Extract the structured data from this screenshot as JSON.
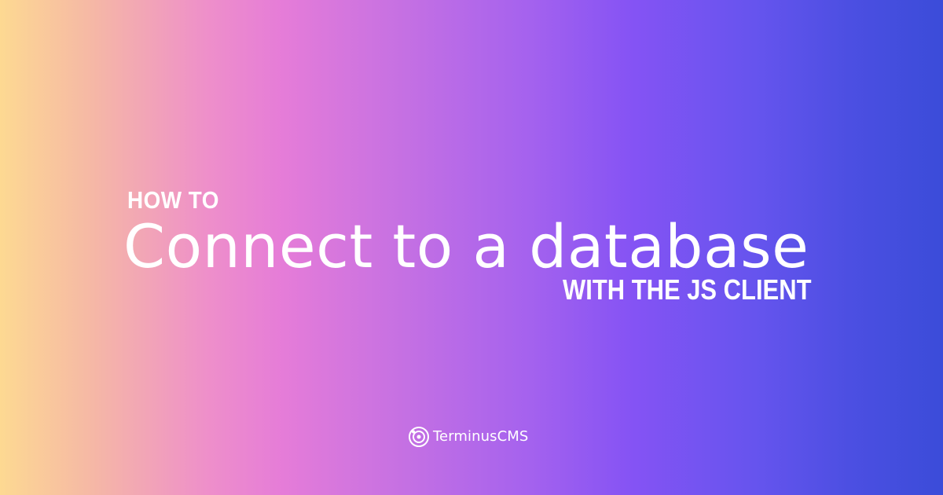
{
  "banner": {
    "kicker": "HOW TO",
    "headline": "Connect to a database",
    "subline": "WITH THE JS CLIENT",
    "gradient_colors": [
      "#fdd992",
      "#ee8fca",
      "#a562ee",
      "#8553f4",
      "#3b4cd9"
    ]
  },
  "brand": {
    "icon": "terminuscms-logo-icon",
    "name": "TerminusCMS"
  }
}
